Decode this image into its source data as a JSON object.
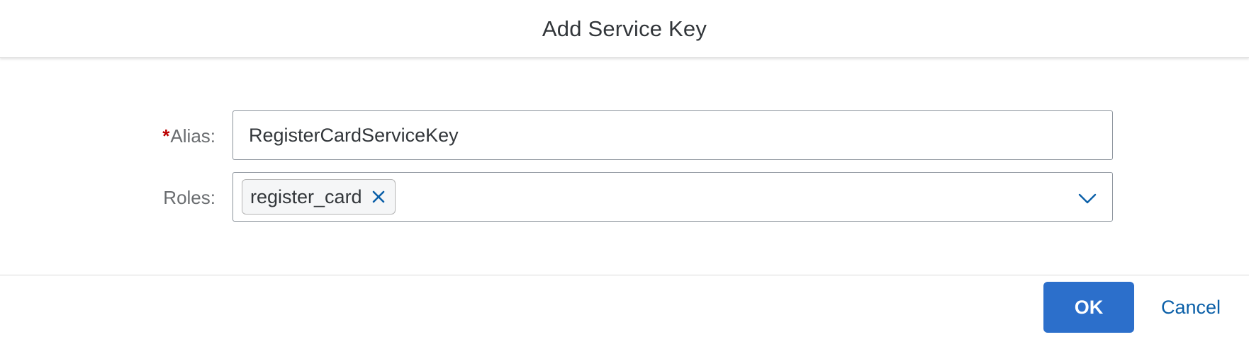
{
  "dialog": {
    "title": "Add Service Key"
  },
  "form": {
    "alias": {
      "required_marker": "*",
      "label": "Alias:",
      "value": "RegisterCardServiceKey"
    },
    "roles": {
      "label": "Roles:",
      "tokens": [
        {
          "text": "register_card"
        }
      ],
      "close_icon": "close-icon",
      "dropdown_icon": "chevron-down-icon"
    }
  },
  "footer": {
    "ok_label": "OK",
    "cancel_label": "Cancel"
  },
  "colors": {
    "primary": "#2c6fcb",
    "link": "#0a5fa8",
    "required": "#bb0000",
    "label": "#6a6d70",
    "text": "#32363a"
  }
}
